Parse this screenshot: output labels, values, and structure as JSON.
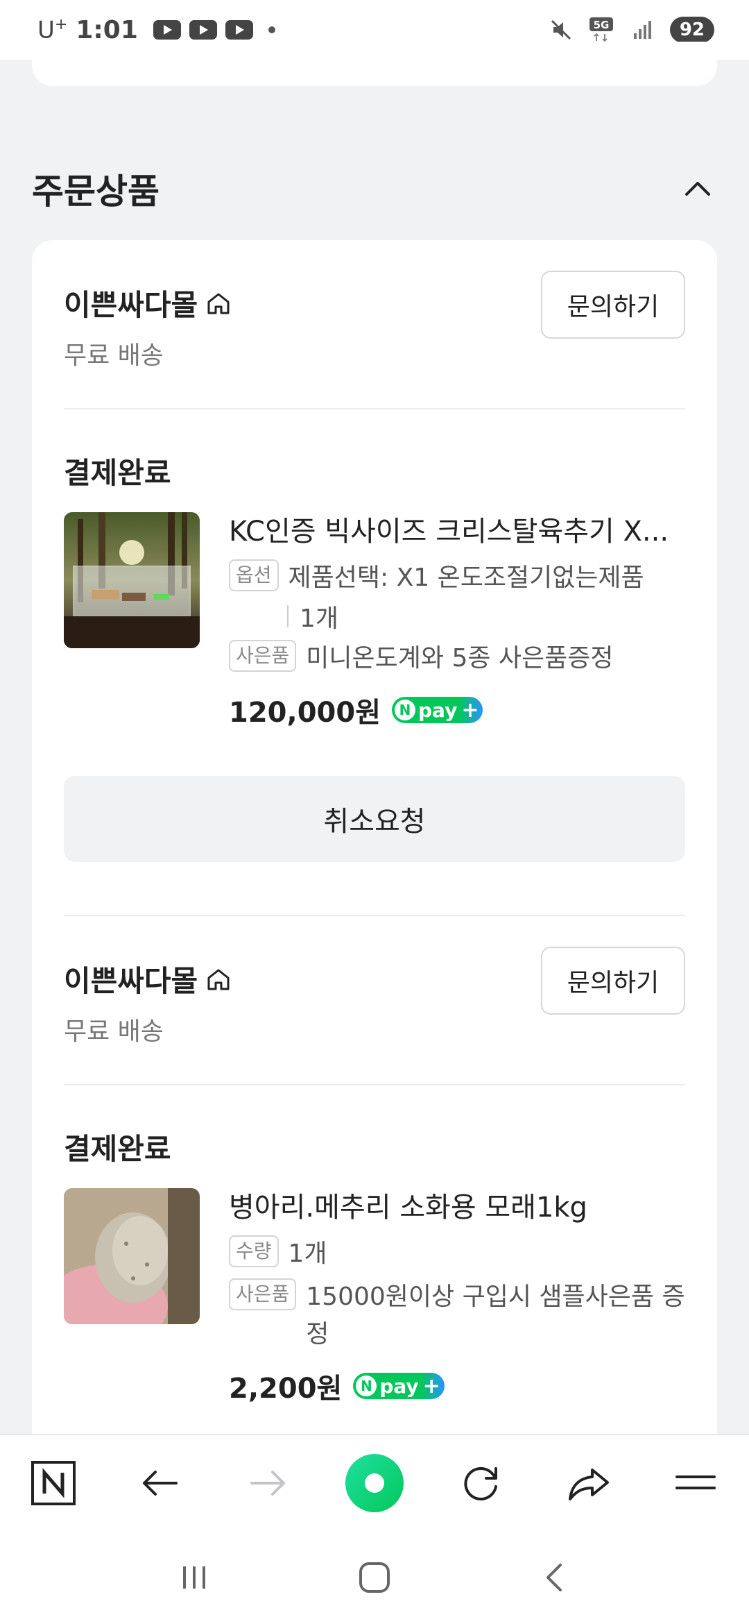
{
  "status_bar": {
    "carrier": "U",
    "carrier_sup": "+",
    "time": "1:01",
    "battery": "92"
  },
  "section": {
    "title": "주문상품"
  },
  "orders": [
    {
      "shop_name": "이쁜싸다몰",
      "shipping": "무료 배송",
      "inquiry_label": "문의하기",
      "status": "결제완료",
      "product_name": "KC인증 빅사이즈 크리스탈육추기 X...",
      "option_tag": "옵션",
      "option_text": "제품선택: X1 온도조절기없는제품",
      "quantity": "1개",
      "gift_tag": "사은품",
      "gift_text": "미니온도계와 5종 사은품증정",
      "price": "120,000원",
      "npay": "pay",
      "action_label": "취소요청"
    },
    {
      "shop_name": "이쁜싸다몰",
      "shipping": "무료 배송",
      "inquiry_label": "문의하기",
      "status": "결제완료",
      "product_name": "병아리.메추리 소화용 모래1kg",
      "qty_tag": "수량",
      "quantity": "1개",
      "gift_tag": "사은품",
      "gift_text": "15000원이상 구입시 샘플사은품 증정",
      "price": "2,200원",
      "npay": "pay"
    }
  ],
  "toolbar": {
    "icons": [
      "naver-home-icon",
      "back-arrow-icon",
      "forward-arrow-icon",
      "green-dot-icon",
      "refresh-icon",
      "share-icon",
      "menu-icon"
    ]
  }
}
